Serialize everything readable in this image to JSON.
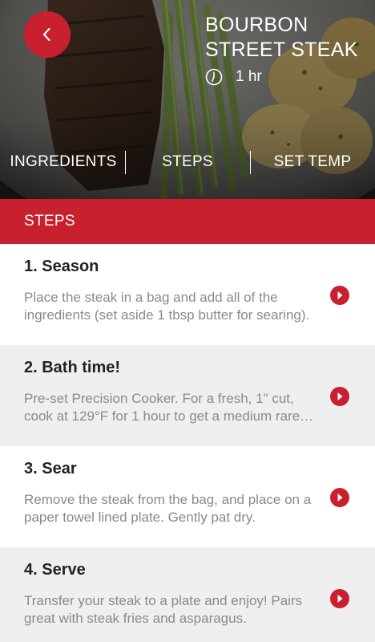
{
  "header": {
    "title": "BOURBON STREET STEAK",
    "duration": "1 hr"
  },
  "tabs": [
    {
      "label": "INGREDIENTS"
    },
    {
      "label": "STEPS"
    },
    {
      "label": "SET TEMP"
    }
  ],
  "section": {
    "title": "STEPS"
  },
  "steps": [
    {
      "title": "1. Season",
      "description": "Place the steak in a bag and add all of the ingredients (set aside 1 tbsp butter for searing)."
    },
    {
      "title": "2. Bath time!",
      "description": "Pre-set Precision Cooker. For a fresh, 1\" cut, cook at 129°F for 1 hour to get a medium rare steak."
    },
    {
      "title": "3. Sear",
      "description": "Remove the steak from the bag, and place on a paper towel lined plate. Gently pat dry."
    },
    {
      "title": "4. Serve",
      "description": "Transfer your steak to a plate and enjoy! Pairs great with steak fries and asparagus."
    }
  ],
  "colors": {
    "accent": "#c8202e",
    "alt_row": "#efefef",
    "title_text": "#222222",
    "body_text": "#8a8a8a"
  },
  "icons": {
    "back": "chevron-left-icon",
    "duration": "clock-icon",
    "step_action": "play-arrow-icon"
  }
}
